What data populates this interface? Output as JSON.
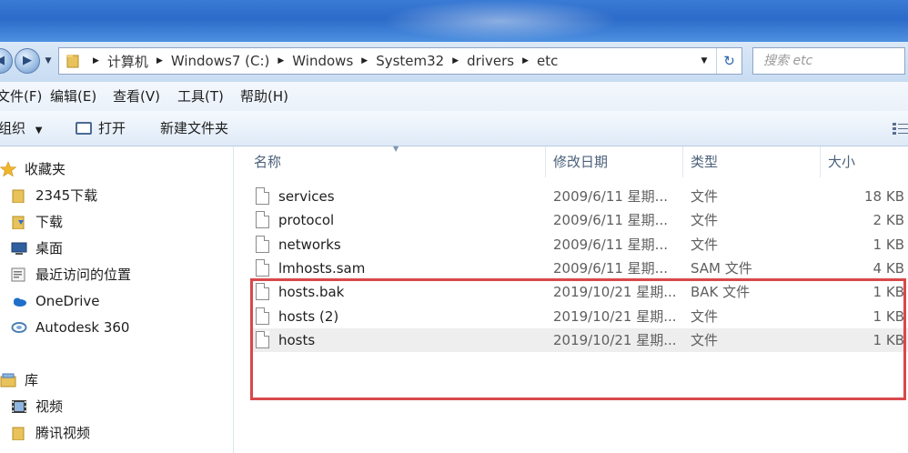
{
  "address": {
    "breadcrumbs": [
      "计算机",
      "Windows7 (C:)",
      "Windows",
      "System32",
      "drivers",
      "etc"
    ]
  },
  "search": {
    "placeholder": "搜索 etc"
  },
  "menu": [
    "文件(F)",
    "编辑(E)",
    "查看(V)",
    "工具(T)",
    "帮助(H)"
  ],
  "toolbar": {
    "organize_label": "组织",
    "open_label": "打开",
    "new_folder_label": "新建文件夹"
  },
  "nav": {
    "favorites_label": "收藏夹",
    "favorites": [
      "2345下载",
      "下载",
      "桌面",
      "最近访问的位置"
    ],
    "onedrive_label": "OneDrive",
    "autodesk_label": "Autodesk 360",
    "libraries_label": "库",
    "libraries": [
      "视频",
      "腾讯视频"
    ]
  },
  "columns": {
    "name": "名称",
    "date": "修改日期",
    "type": "类型",
    "size": "大小"
  },
  "files": [
    {
      "name": "services",
      "date": "2009/6/11 星期...",
      "type": "文件",
      "size": "18 KB"
    },
    {
      "name": "protocol",
      "date": "2009/6/11 星期...",
      "type": "文件",
      "size": "2 KB"
    },
    {
      "name": "networks",
      "date": "2009/6/11 星期...",
      "type": "文件",
      "size": "1 KB"
    },
    {
      "name": "lmhosts.sam",
      "date": "2009/6/11 星期...",
      "type": "SAM 文件",
      "size": "4 KB"
    },
    {
      "name": "hosts.bak",
      "date": "2019/10/21 星期...",
      "type": "BAK 文件",
      "size": "1 KB"
    },
    {
      "name": "hosts (2)",
      "date": "2019/10/21 星期...",
      "type": "文件",
      "size": "1 KB"
    },
    {
      "name": "hosts",
      "date": "2019/10/21 星期...",
      "type": "文件",
      "size": "1 KB"
    }
  ],
  "colors": {
    "titlebar": "#2c6bc9",
    "highlight_box": "#d9484b",
    "selected_row": "#eeeeee"
  }
}
